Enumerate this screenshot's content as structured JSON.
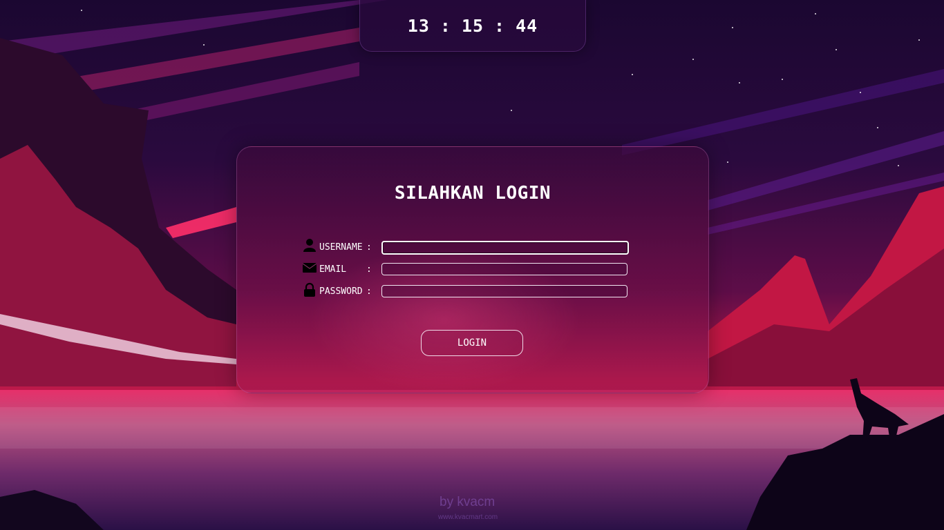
{
  "clock": {
    "hours": "13",
    "minutes": "15",
    "seconds": "44",
    "separator": ":"
  },
  "login": {
    "title": "SILAHKAN LOGIN",
    "fields": [
      {
        "label": "USERNAME",
        "icon": "user-icon",
        "value": ""
      },
      {
        "label": "EMAIL   ",
        "icon": "envelope-icon",
        "value": ""
      },
      {
        "label": "PASSWORD",
        "icon": "lock-icon",
        "value": ""
      }
    ],
    "colon": ":",
    "button_label": "LOGIN"
  },
  "footer": {
    "brand": "by kvacm",
    "url": "www.kvacmart.com"
  },
  "colors": {
    "accent": "#e0306a",
    "panel": "#4a0d45",
    "sky": "#1a0730"
  }
}
